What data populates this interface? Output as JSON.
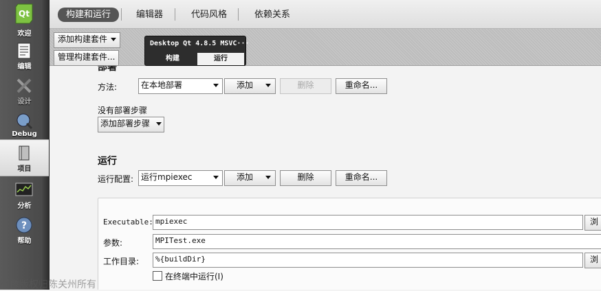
{
  "modes": [
    {
      "label": "欢迎",
      "icon": "qt-logo-icon"
    },
    {
      "label": "编辑",
      "icon": "edit-document-icon"
    },
    {
      "label": "设计",
      "icon": "design-tools-icon"
    },
    {
      "label": "Debug",
      "icon": "debug-bug-icon"
    },
    {
      "label": "项目",
      "icon": "project-folder-icon",
      "active": true
    },
    {
      "label": "分析",
      "icon": "analyze-monitor-icon"
    },
    {
      "label": "帮助",
      "icon": "help-question-icon"
    }
  ],
  "top_tabs": [
    "构建和运行",
    "编辑器",
    "代码风格",
    "依赖关系"
  ],
  "kit": {
    "add_kit": "添加构建套件",
    "manage_kits": "管理构建套件...",
    "kit_name": "Desktop Qt 4.8.5 MSVC···",
    "tab_build": "构建",
    "tab_run": "运行"
  },
  "deploy": {
    "heading": "部署",
    "method_label": "方法:",
    "method_value": "在本地部署",
    "add": "添加",
    "delete": "删除",
    "rename": "重命名...",
    "no_steps": "没有部署步骤",
    "add_step": "添加部署步骤"
  },
  "run": {
    "heading": "运行",
    "config_label": "运行配置:",
    "config_value": "运行mpiexec",
    "add": "添加",
    "delete": "删除",
    "rename": "重命名...",
    "executable_label": "Executable:",
    "executable_value": "mpiexec",
    "args_label": "参数:",
    "args_value": "MPITest.exe",
    "workdir_label": "工作目录:",
    "workdir_value": "%{buildDir}",
    "browse_label": "浏",
    "terminal_label": "在终端中运行(I)",
    "terminal_checked": false
  },
  "watermark": "图像版权归陈关州所有",
  "colors": {
    "modebar": "#4a4a4a",
    "active_tab": "#555555",
    "kit_box": "#2d2d2d"
  }
}
